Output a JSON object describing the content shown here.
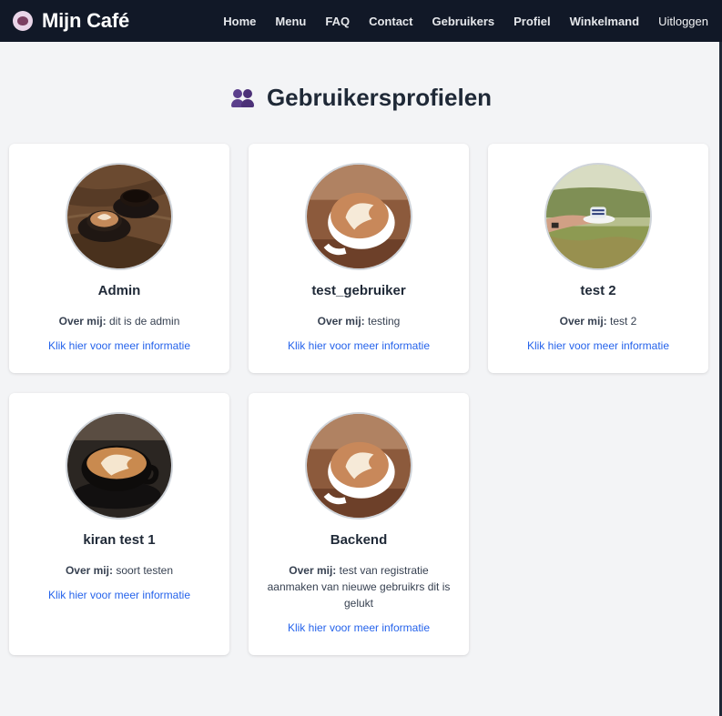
{
  "navbar": {
    "brand": "Mijn Café",
    "links": [
      "Home",
      "Menu",
      "FAQ",
      "Contact",
      "Gebruikers",
      "Profiel",
      "Winkelmand"
    ],
    "logout": "Uitloggen"
  },
  "page": {
    "title": "Gebruikersprofielen"
  },
  "about_label": "Over mij:",
  "more_link": "Klik hier voor meer informatie",
  "users": [
    {
      "name": "Admin",
      "about": "dit is de admin",
      "photo": "coffee-table-icon"
    },
    {
      "name": "test_gebruiker",
      "about": "testing",
      "photo": "latte-art-icon"
    },
    {
      "name": "test 2",
      "about": "test 2",
      "photo": "espresso-in-hand-icon"
    },
    {
      "name": "kiran test 1",
      "about": "soort testen",
      "photo": "black-cup-latte-icon"
    },
    {
      "name": "Backend",
      "about": "test van registratie aanmaken van nieuwe gebruikrs dit is gelukt",
      "photo": "latte-art-icon"
    }
  ]
}
